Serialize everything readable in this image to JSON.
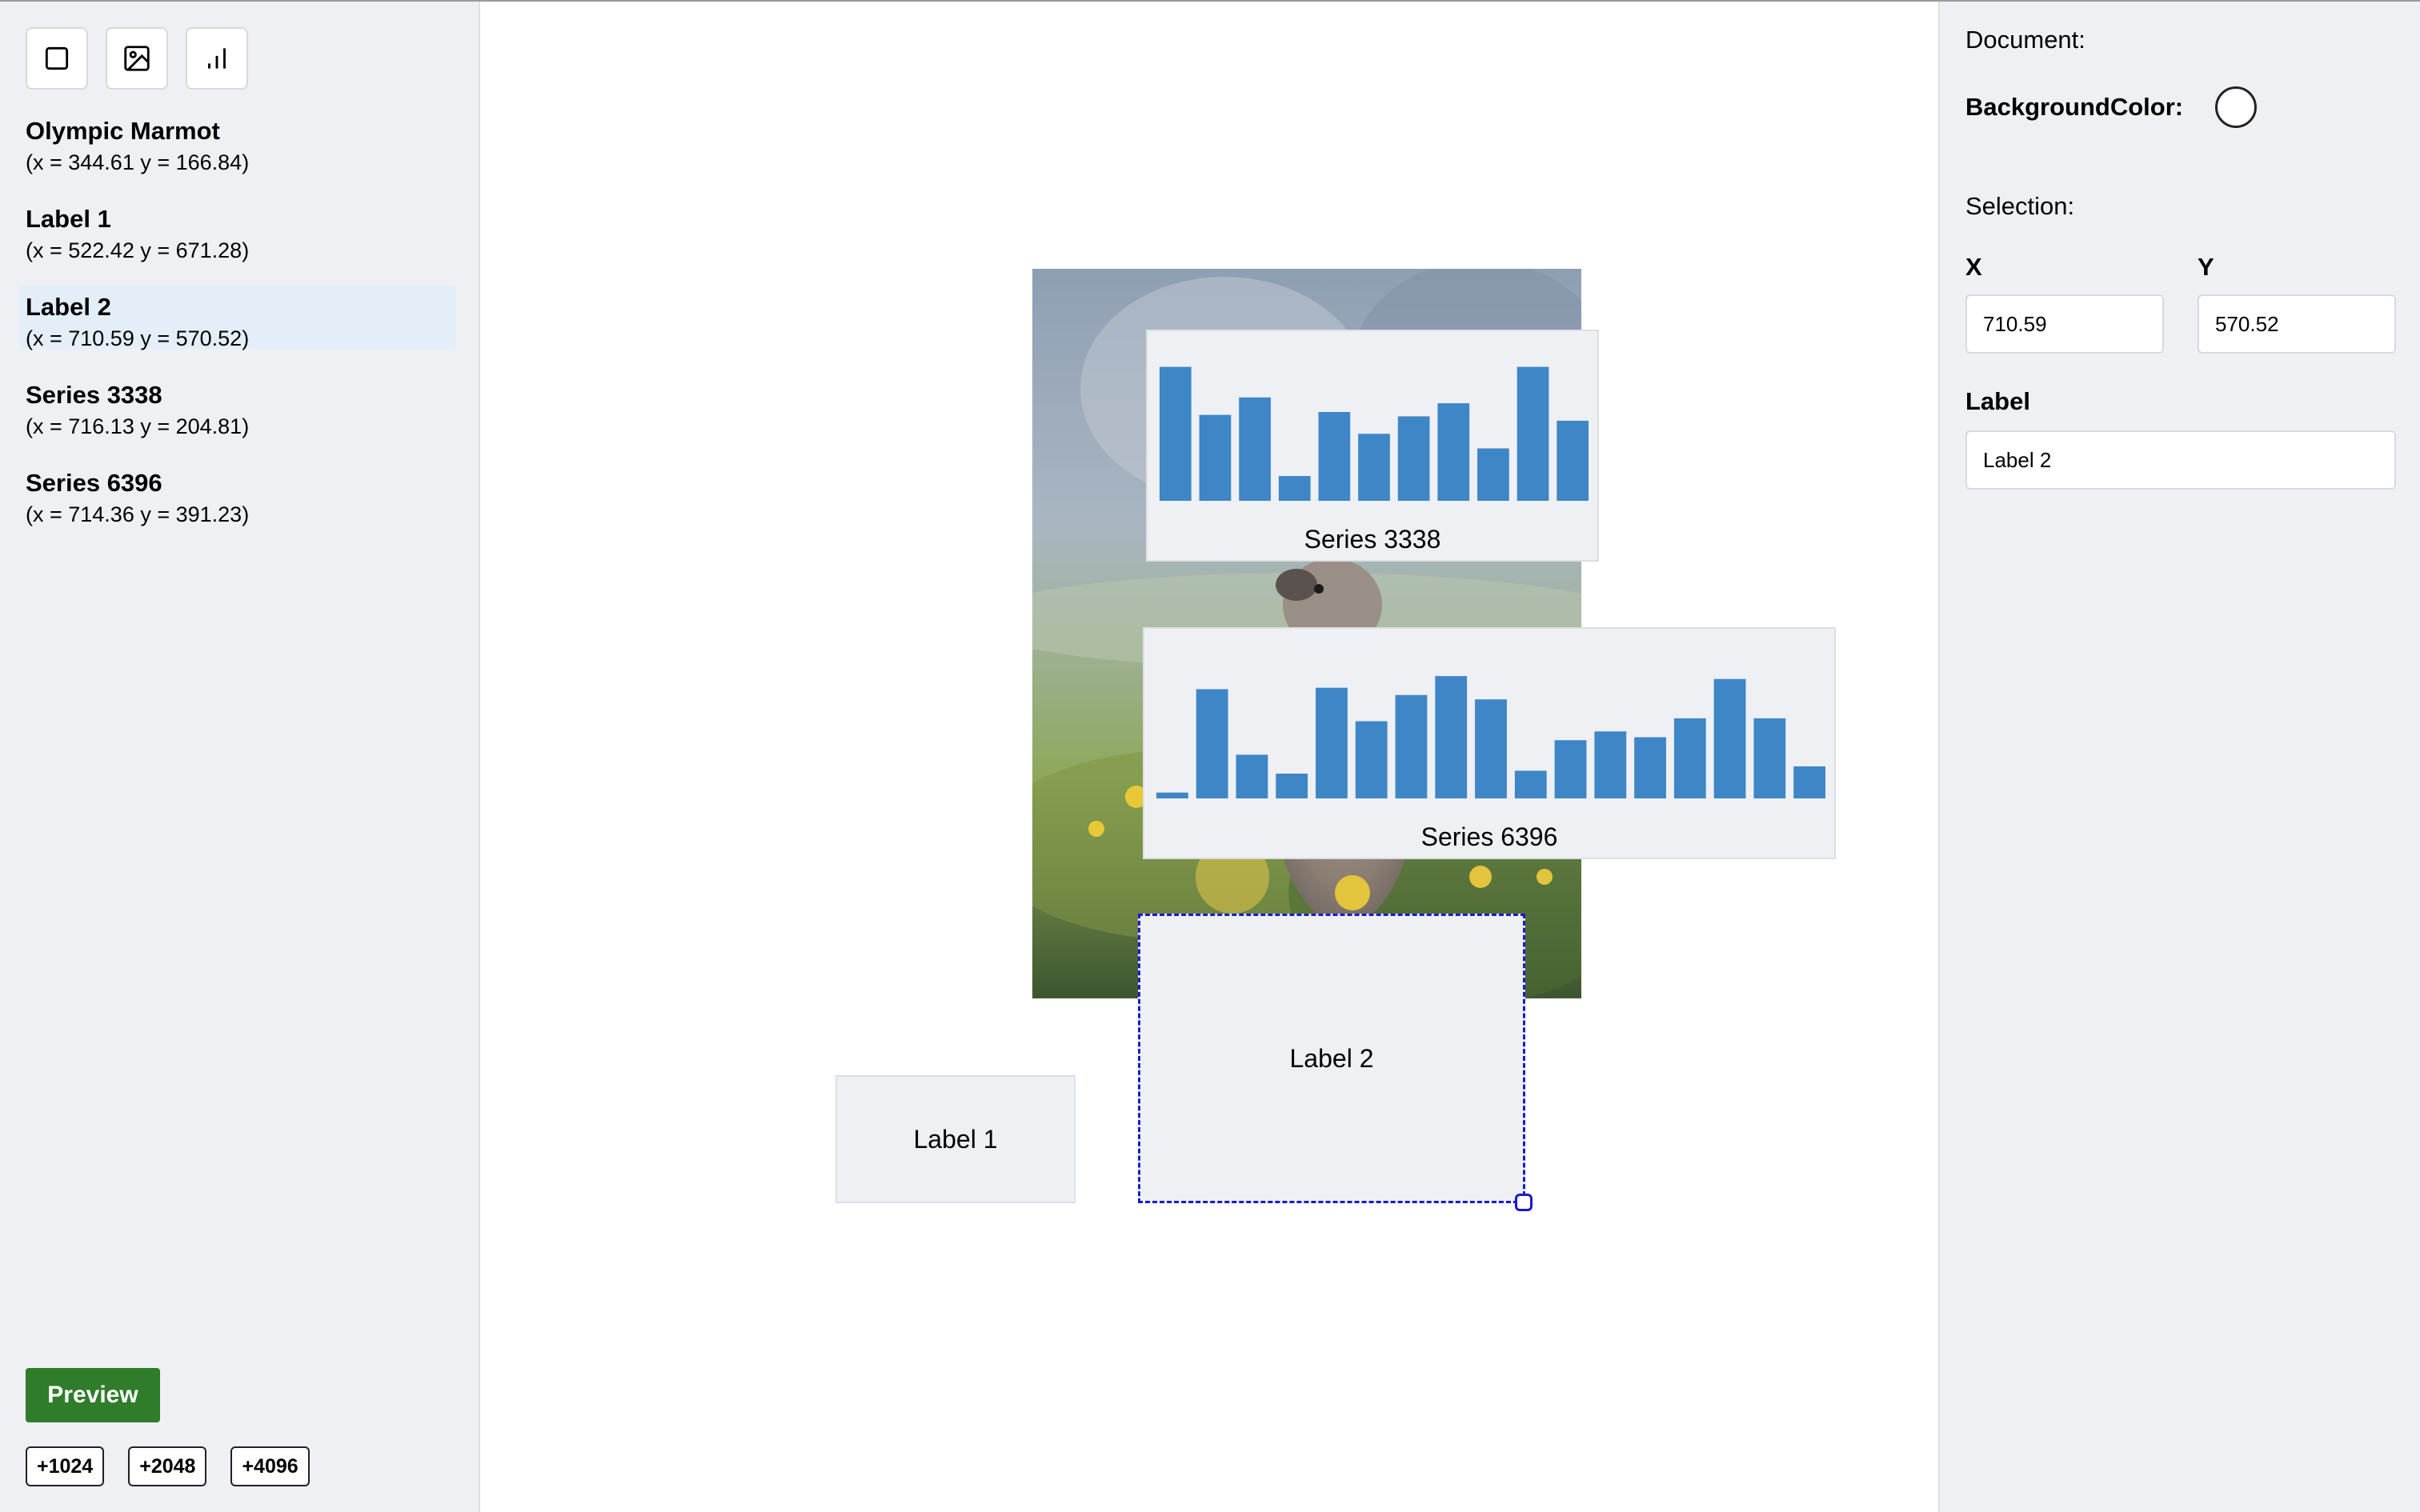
{
  "toolbar": {
    "tools": [
      {
        "icon": "rectangle-icon"
      },
      {
        "icon": "image-icon"
      },
      {
        "icon": "bar-chart-icon"
      }
    ]
  },
  "layers": [
    {
      "name": "Olympic Marmot",
      "coords": "(x = 344.61 y = 166.84)"
    },
    {
      "name": "Label 1",
      "coords": "(x = 522.42 y = 671.28)"
    },
    {
      "name": "Label 2",
      "coords": "(x = 710.59 y = 570.52)",
      "selected": true
    },
    {
      "name": "Series 3338",
      "coords": "(x = 716.13 y = 204.81)"
    },
    {
      "name": "Series 6396",
      "coords": "(x = 714.36 y = 391.23)"
    }
  ],
  "actions": {
    "preview_label": "Preview",
    "add_buttons": [
      "+1024",
      "+2048",
      "+4096"
    ]
  },
  "canvas": {
    "label1": "Label 1",
    "label2": "Label 2",
    "series_a_caption": "Series 3338",
    "series_b_caption": "Series 6396"
  },
  "colors": {
    "bar": "#3e86c6",
    "preview_button": "#2f7d2a",
    "selection": "#1a1acc"
  },
  "properties": {
    "document_heading": "Document:",
    "background_color_label": "BackgroundColor:",
    "selection_heading": "Selection:",
    "x_label": "X",
    "y_label": "Y",
    "x_value": "710.59",
    "y_value": "570.52",
    "label_label": "Label",
    "label_value": "Label 2"
  },
  "chart_data": [
    {
      "type": "bar",
      "title": "Series 3338",
      "values": [
        92,
        59,
        71,
        17,
        61,
        46,
        58,
        67,
        36,
        92,
        55
      ],
      "ylim": [
        0,
        100
      ]
    },
    {
      "type": "bar",
      "title": "Series 6396",
      "values": [
        4,
        75,
        30,
        17,
        76,
        53,
        71,
        84,
        68,
        19,
        40,
        46,
        42,
        55,
        82,
        55,
        22
      ],
      "ylim": [
        0,
        100
      ]
    }
  ]
}
